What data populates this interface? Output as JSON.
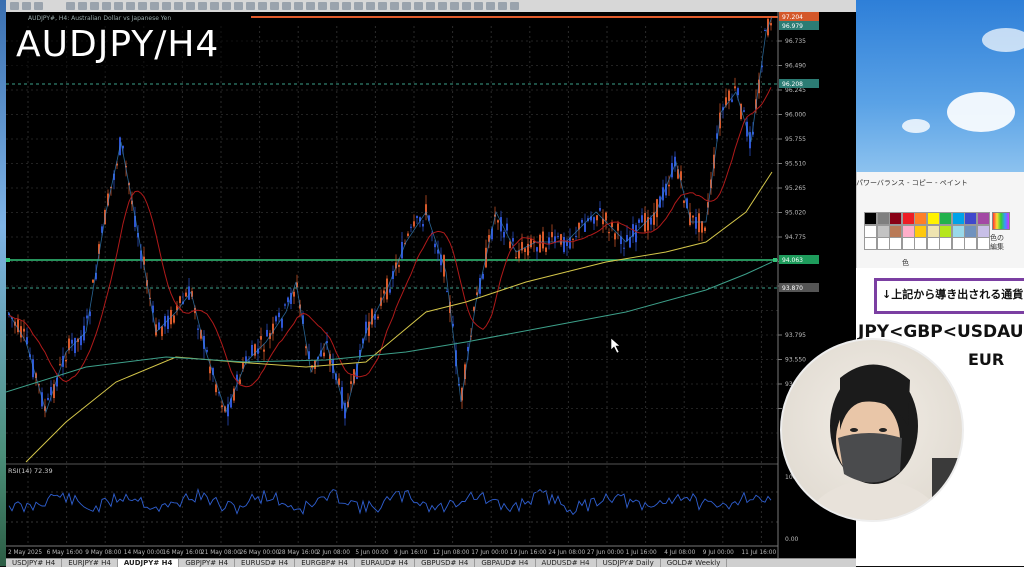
{
  "window": {
    "symbol_line": "AUDJPY#, H4: Australian Dollar vs Japanese Yen"
  },
  "overlay": {
    "title": "AUDJPY/H4"
  },
  "rsi": {
    "label": "RSI(14) 72.39"
  },
  "price_axis": {
    "labels": [
      "96.735",
      "96.490",
      "96.245",
      "96.000",
      "95.755",
      "95.510",
      "95.265",
      "95.020",
      "94.775",
      "94.530",
      "94.285",
      "93.795",
      "93.550",
      "93.305",
      "93.060"
    ],
    "highlight_red": "97.204",
    "highlight_teal1": "96.979",
    "highlight_teal2": "96.208",
    "highlight_green": "94.063",
    "highlight_grey": "93.870",
    "rsi_labels": [
      "100.00",
      "0.00"
    ]
  },
  "time_axis": [
    "2 May 2025",
    "6 May 16:00",
    "9 May 08:00",
    "14 May 00:00",
    "16 May 16:00",
    "21 May 08:00",
    "26 May 00:00",
    "28 May 16:00",
    "2 Jun 08:00",
    "5 Jun 00:00",
    "9 Jun 16:00",
    "12 Jun 08:00",
    "17 Jun 00:00",
    "19 Jun 16:00",
    "24 Jun 08:00",
    "27 Jun 00:00",
    "1 Jul 16:00",
    "4 Jul 08:00",
    "9 Jul 00:00",
    "11 Jul 16:00"
  ],
  "tabs": [
    "USDJPY# H4",
    "EURJPY# H4",
    "AUDJPY# H4",
    "GBPJPY# H4",
    "EURUSD# H4",
    "EURGBP# H4",
    "EURAUD# H4",
    "GBPUSD# H4",
    "GBPAUD# H4",
    "AUDUSD# H4",
    "USDJPY# Daily",
    "GOLD# Weekly"
  ],
  "active_tab": "AUDJPY# H4",
  "paint": {
    "title": "パワーバランス - コピー - ペイント",
    "color_edit": "色の編集",
    "color_label": "色"
  },
  "slide": {
    "note": "↓上記から導き出される通貨",
    "order_line": "JPY<GBP<USDAUD",
    "order_line2": "EUR"
  },
  "colors": {
    "bull": "#d95a2b",
    "bear": "#2f55d4",
    "ma_red": "#b01a1a",
    "ma_yellow": "#d4c64a",
    "ma_green": "#3da08a",
    "hline_green": "#32c47a",
    "accent_purple": "#7b3fa2"
  }
}
